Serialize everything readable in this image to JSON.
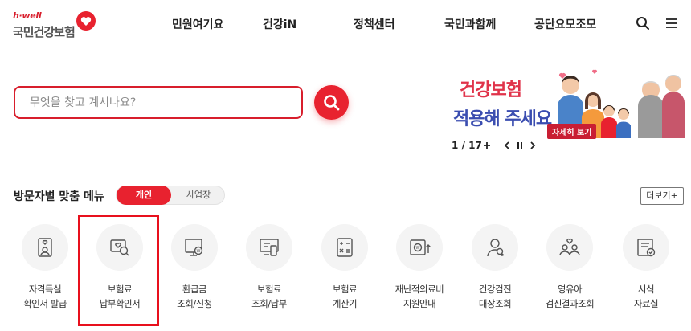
{
  "logo": {
    "tagline": "h·well",
    "name": "국민건강보험"
  },
  "nav": [
    "민원여기요",
    "건강iN",
    "정책센터",
    "국민과함께",
    "공단요모조모"
  ],
  "search": {
    "placeholder": "무엇을 찾고 계시나요?"
  },
  "banner": {
    "title1": "건강보험",
    "title2": "적용해 주세요",
    "detail": "자세히 보기"
  },
  "pager": {
    "current": "1",
    "total": "17",
    "count_text": "1 / 17"
  },
  "menu_section": {
    "title": "방문자별 맞춤 메뉴",
    "toggle_on": "개인",
    "toggle_off": "사업장",
    "more": "더보기+",
    "items": [
      {
        "line1": "자격득실",
        "line2": "확인서 발급",
        "icon": "certificate-icon"
      },
      {
        "line1": "보험료",
        "line2": "납부확인서",
        "icon": "payment-confirm-icon"
      },
      {
        "line1": "환급금",
        "line2": "조회/신청",
        "icon": "refund-icon"
      },
      {
        "line1": "보험료",
        "line2": "조회/납부",
        "icon": "premium-inquiry-icon"
      },
      {
        "line1": "보험료",
        "line2": "계산기",
        "icon": "calculator-icon"
      },
      {
        "line1": "재난적의료비",
        "line2": "지원안내",
        "icon": "medical-support-icon"
      },
      {
        "line1": "건강검진",
        "line2": "대상조회",
        "icon": "checkup-icon"
      },
      {
        "line1": "영유아",
        "line2": "검진결과조회",
        "icon": "infant-icon"
      },
      {
        "line1": "서식",
        "line2": "자료실",
        "icon": "forms-icon"
      }
    ]
  },
  "colors": {
    "brand_red": "#e8222f",
    "highlight": "#e8101d"
  }
}
